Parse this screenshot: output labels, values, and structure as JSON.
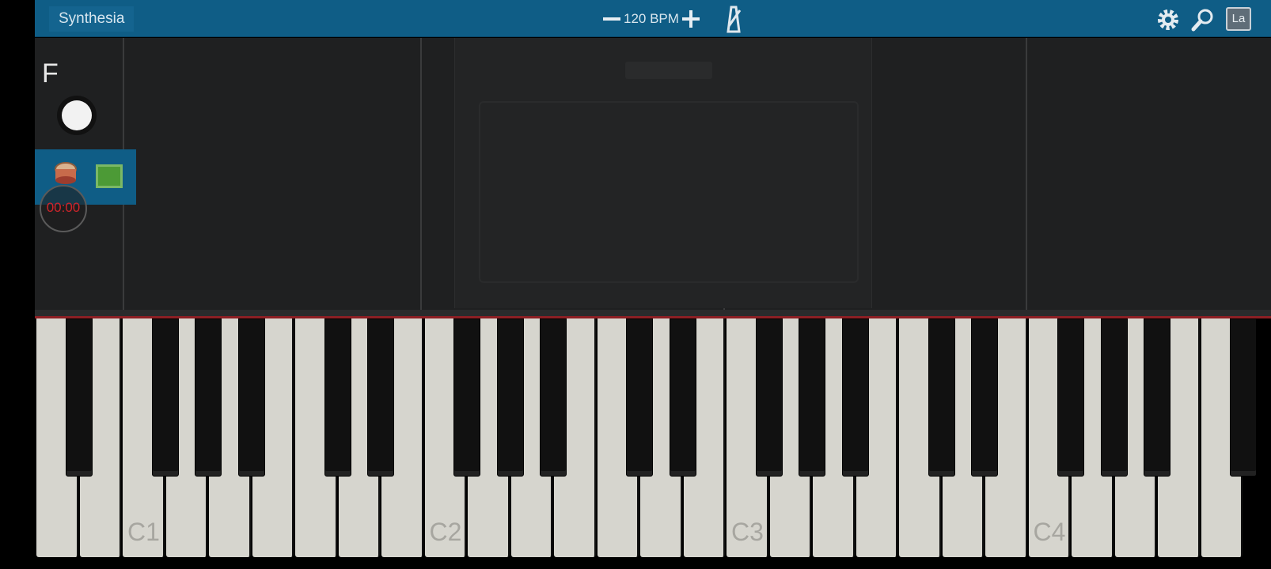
{
  "header": {
    "app_title": "Synthesia",
    "bpm_label": "120 BPM",
    "labels_button": "La"
  },
  "sidebar": {
    "hand_letter": "F",
    "timer": "00:00"
  },
  "keyboard": {
    "octave_labels": [
      "C1",
      "C2",
      "C3",
      "C4"
    ],
    "white_key_count": 28,
    "visible_black_keys": true
  },
  "colors": {
    "toolbar": "#0f5d86",
    "waterfall": "#1f2021",
    "timer": "#d0242b",
    "track_green": "#4c9a36",
    "white_key": "#d6d5ce"
  },
  "icons": [
    "minus-icon",
    "plus-icon",
    "metronome-icon",
    "gear-icon",
    "search-icon",
    "drum-icon"
  ]
}
